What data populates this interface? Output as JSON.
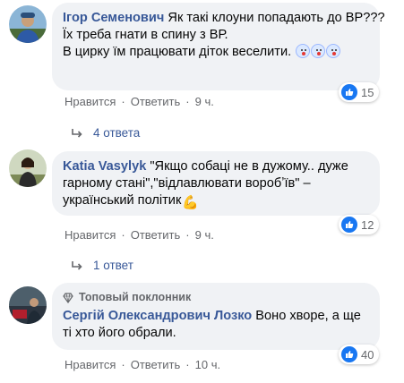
{
  "comments": [
    {
      "author": "Ігор Семенович",
      "text_lines": [
        "Як такі клоуни попадають до ВР???",
        "Їх треба гнати в спину з ВР.",
        "В цирку їм працювати діток веселити."
      ],
      "reactions": "15",
      "actions": {
        "like": "Нравится",
        "reply": "Ответить",
        "time": "9 ч."
      },
      "replies_label": "4 ответа"
    },
    {
      "author": "Katia Vasylyk",
      "text": "\"Якщо собаці не в дужому.. дуже гарному стані\",\"відлавлювати воробʼїв\" – український політик",
      "reactions": "12",
      "actions": {
        "like": "Нравится",
        "reply": "Ответить",
        "time": "9 ч."
      },
      "replies_label": "1 ответ"
    },
    {
      "badge": "Топовый поклонник",
      "author": "Сергій Олександрович Лозко",
      "text": "Воно хворе, а ще ті хто його обрали.",
      "reactions": "40",
      "actions": {
        "like": "Нравится",
        "reply": "Ответить",
        "time": "10 ч."
      }
    }
  ],
  "icons": {
    "like": "thumbs-up-icon",
    "reply": "reply-arrow-icon",
    "badge": "diamond-icon",
    "clown": "clown-emoji-icon",
    "flex": "flexed-biceps-icon"
  },
  "colors": {
    "author": "#385898",
    "bubble": "#f0f2f5",
    "meta": "#65676b",
    "like": "#1877f2"
  }
}
